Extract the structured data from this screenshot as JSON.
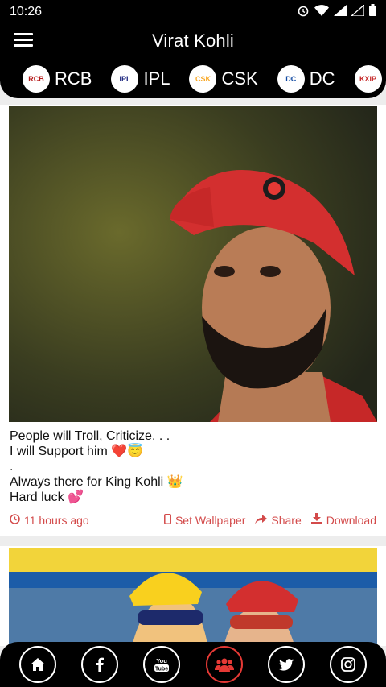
{
  "status": {
    "time": "10:26"
  },
  "app": {
    "title": "Virat Kohli"
  },
  "teams": [
    {
      "name": "RCB",
      "logo_text": "RCB",
      "color": "#b71c1c"
    },
    {
      "name": "IPL",
      "logo_text": "IPL",
      "color": "#1a237e"
    },
    {
      "name": "CSK",
      "logo_text": "CSK",
      "color": "#f9a825"
    },
    {
      "name": "DC",
      "logo_text": "DC",
      "color": "#0d47a1"
    },
    {
      "name": "",
      "logo_text": "KXIP",
      "color": "#c62828"
    }
  ],
  "posts": [
    {
      "caption_line1": "People will Troll, Criticize. . .",
      "caption_line2": "I will Support him ❤️😇",
      "caption_line3": ".",
      "caption_line4": "Always there for King Kohli 👑",
      "caption_line5": "Hard luck 💕",
      "time": "11 hours ago",
      "set_wallpaper": "Set Wallpaper",
      "share": "Share",
      "download": "Download"
    }
  ],
  "bottom_nav": [
    {
      "name": "home-icon"
    },
    {
      "name": "facebook-icon"
    },
    {
      "name": "youtube-icon"
    },
    {
      "name": "group-icon"
    },
    {
      "name": "twitter-icon"
    },
    {
      "name": "instagram-icon"
    }
  ],
  "colors": {
    "accent": "#d34a4a",
    "bar": "#000000",
    "card": "#ffffff"
  }
}
